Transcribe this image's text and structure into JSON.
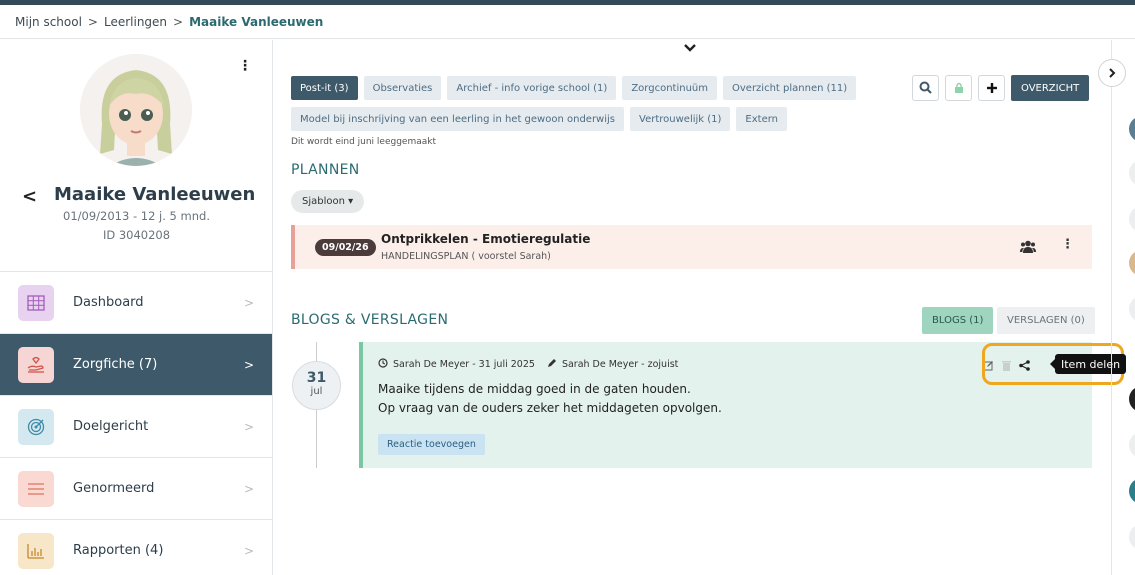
{
  "breadcrumb": {
    "items": [
      "Mijn school",
      "Leerlingen"
    ],
    "separator": ">",
    "current": "Maaike Vanleeuwen"
  },
  "student": {
    "name": "Maaike Vanleeuwen",
    "dob": "01/09/2013 - 12 j. 5 mnd.",
    "id": "ID 3040208"
  },
  "nav": {
    "chevron": ">",
    "items": [
      {
        "label": "Dashboard",
        "icon": "grid-icon",
        "color": "#e7d3f0"
      },
      {
        "label": "Zorgfiche  (7)",
        "icon": "hands-icon",
        "color": "#f6d6d4",
        "active": true
      },
      {
        "label": "Doelgericht",
        "icon": "target-icon",
        "color": "#d4e8ef"
      },
      {
        "label": "Genormeerd",
        "icon": "lines-icon",
        "color": "#fad9d3"
      },
      {
        "label": "Rapporten  (4)",
        "icon": "bar-chart-icon",
        "color": "#f7e6c8"
      }
    ]
  },
  "tabs": {
    "row1": [
      "Post-it (3)",
      "Observaties",
      "Archief - info vorige school (1)",
      "Zorgcontinuüm",
      "Overzicht plannen (11)"
    ],
    "row2": [
      "Model bij inschrijving van een leerling in het gewoon onderwijs",
      "Vertrouwelijk (1)",
      "Extern"
    ]
  },
  "toolbar": {
    "overview_label": "OVERZICHT"
  },
  "hint": "Dit wordt eind juni leeggemaakt",
  "plans": {
    "title": "PLANNEN",
    "template_label": "Sjabloon ▾",
    "card": {
      "date": "09/02/26",
      "title": "Ontprikkelen - Emotieregulatie",
      "subtitle": "HANDELINGSPLAN ( voorstel Sarah)"
    }
  },
  "blogs": {
    "title": "BLOGS & VERSLAGEN",
    "tab_blogs": "BLOGS (1)",
    "tab_reports": "VERSLAGEN (0)",
    "entry": {
      "day": "31",
      "month": "jul",
      "author_created": "Sarah De Meyer - 31 juli 2025",
      "author_edited": "Sarah De Meyer - zojuist",
      "line1": "Maaike tijdens de middag goed in de gaten houden.",
      "line2": "Op vraag van de ouders zeker het middageten opvolgen.",
      "react_label": "Reactie toevoegen"
    },
    "tooltip": "Item delen"
  },
  "colors": {
    "accent": "#3e5a6a",
    "teal": "#2b6b70",
    "highlight": "#f0a720"
  }
}
